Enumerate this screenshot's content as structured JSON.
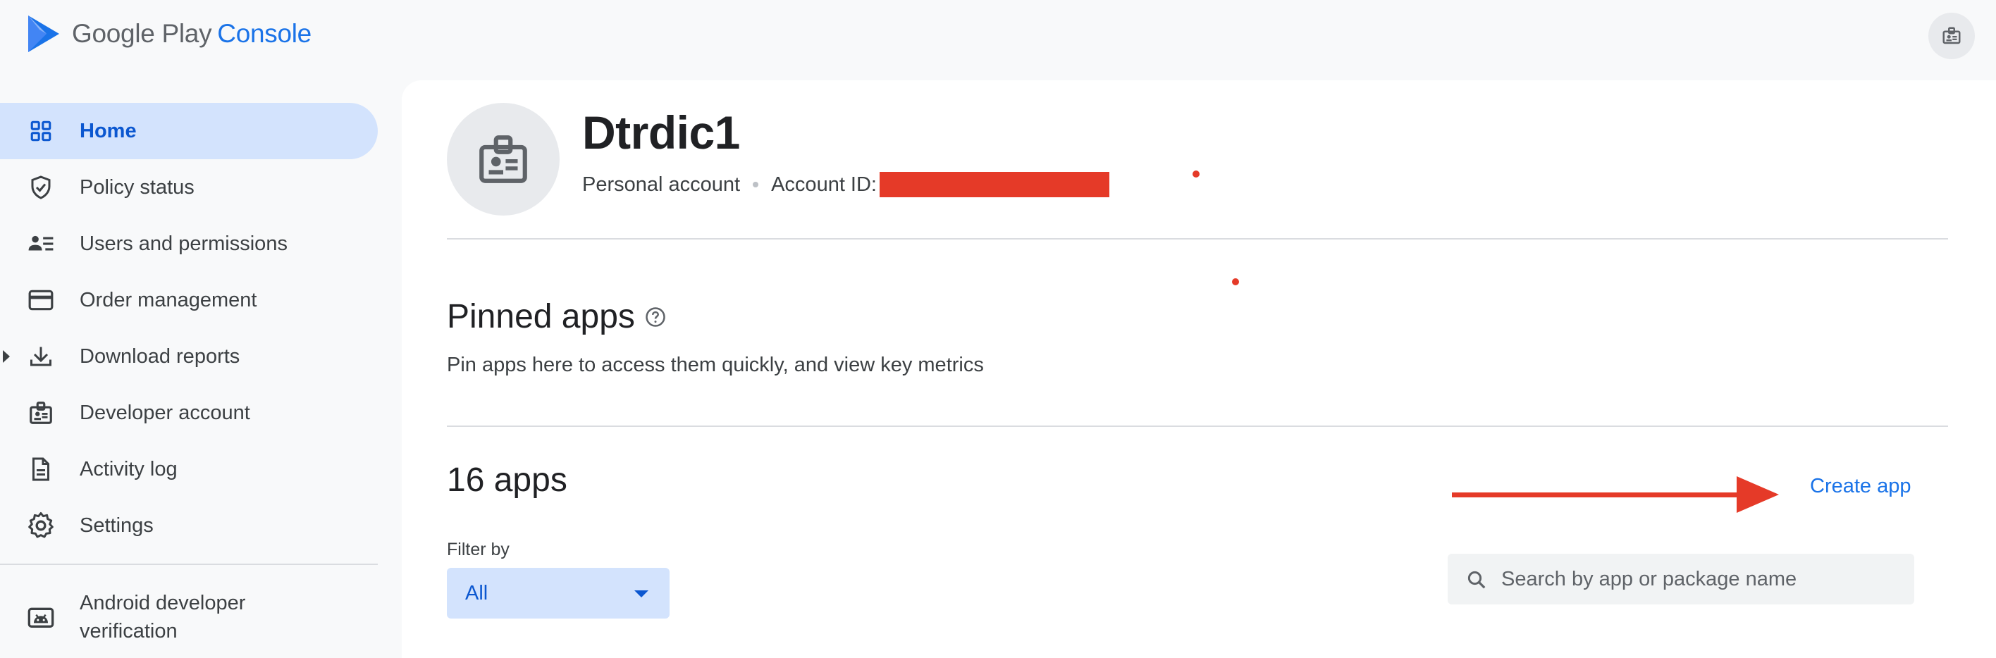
{
  "header": {
    "brand": "Google Play",
    "product": "Console",
    "account_icon": "badge-icon"
  },
  "sidebar": {
    "items": [
      {
        "label": "Home",
        "icon": "grid-icon",
        "active": true
      },
      {
        "label": "Policy status",
        "icon": "shield-check-icon"
      },
      {
        "label": "Users and permissions",
        "icon": "users-list-icon"
      },
      {
        "label": "Order management",
        "icon": "credit-card-icon"
      },
      {
        "label": "Download reports",
        "icon": "download-icon",
        "expandable": true
      },
      {
        "label": "Developer account",
        "icon": "badge-icon"
      },
      {
        "label": "Activity log",
        "icon": "document-icon"
      },
      {
        "label": "Settings",
        "icon": "gear-icon"
      },
      {
        "label": "Android developer verification",
        "icon": "android-icon"
      }
    ]
  },
  "account": {
    "name": "Dtrdic1",
    "type": "Personal account",
    "id_label": "Account ID:",
    "id_value_redacted": true
  },
  "pinned": {
    "title": "Pinned apps",
    "subtitle": "Pin apps here to access them quickly, and view key metrics"
  },
  "apps": {
    "count_label": "16 apps",
    "create_label": "Create app",
    "filter_label": "Filter by",
    "filter_value": "All",
    "search_placeholder": "Search by app or package name"
  },
  "colors": {
    "accent": "#1a73e8",
    "active_bg": "#d3e3fd",
    "annotation_red": "#e53a28"
  }
}
